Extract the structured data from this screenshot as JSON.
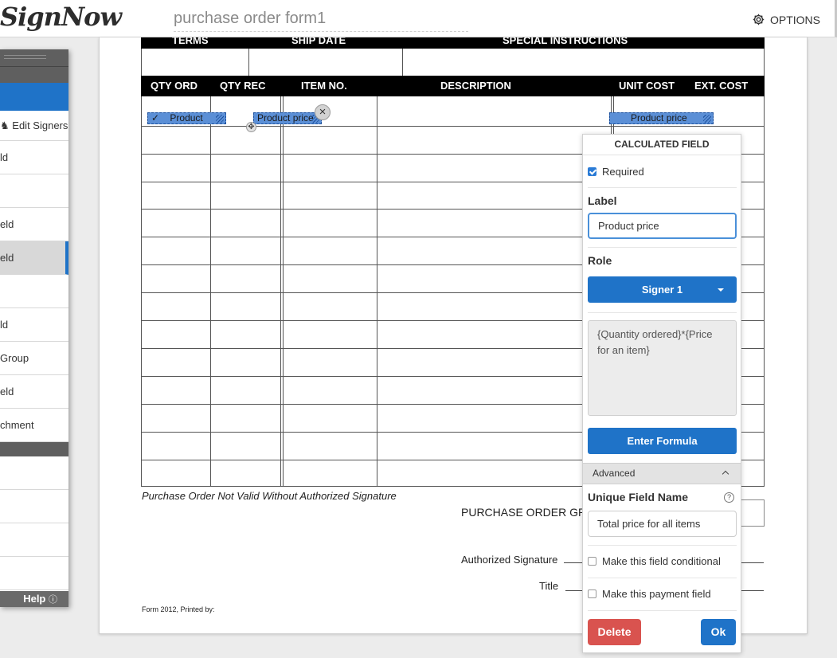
{
  "app": {
    "logo": "SignNow",
    "document_title": "purchase order form1",
    "options_label": "OPTIONS"
  },
  "document": {
    "top_headers": [
      "TERMS",
      "SHIP DATE",
      "SPECIAL INSTRUCTIONS"
    ],
    "table_headers": [
      "QTY ORD",
      "QTY REC",
      "ITEM NO.",
      "DESCRIPTION",
      "UNIT COST",
      "EXT. COST"
    ],
    "fields": {
      "field1": "Product",
      "field1_check": "✓",
      "field2": "Product price",
      "field3": "Product price"
    },
    "footer_note": "Purchase Order Not Valid Without Authorized Signature",
    "grand_total_label": "PURCHASE ORDER GRA",
    "authorized_signature_label": "Authorized Signature",
    "title_label": "Title",
    "form_printed": "Form 2012, Printed by:"
  },
  "sidebar": {
    "items": [
      "Edit Signers",
      "ld",
      "",
      "eld",
      "eld",
      "",
      "ld",
      "Group",
      "eld",
      "chment"
    ],
    "lower_items": [
      "",
      "",
      "",
      ""
    ],
    "help_label": "Help",
    "active_index": 4
  },
  "panel": {
    "title": "CALCULATED FIELD",
    "required_label": "Required",
    "required_checked": true,
    "label_heading": "Label",
    "label_value": "Product price",
    "role_heading": "Role",
    "role_value": "Signer 1",
    "formula_text": "{Quantity ordered}*{Price for an item}",
    "enter_formula_label": "Enter Formula",
    "advanced_label": "Advanced",
    "unique_name_heading": "Unique Field Name",
    "unique_name_value": "Total price for all items",
    "conditional_label": "Make this field conditional",
    "payment_label": "Make this payment field",
    "delete_label": "Delete",
    "ok_label": "Ok"
  },
  "colors": {
    "accent": "#1f73c8",
    "danger": "#d9534f",
    "field_chip": "#5b8fd6"
  }
}
